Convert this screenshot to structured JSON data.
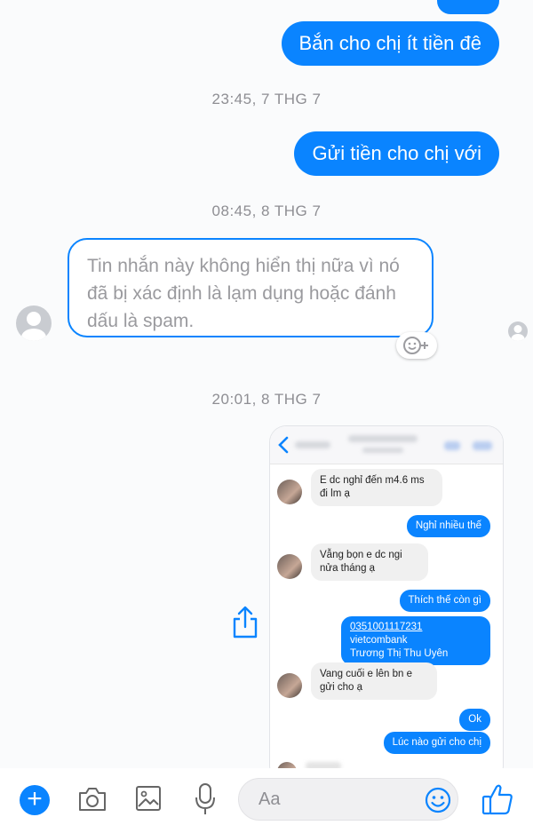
{
  "messages": {
    "out_1": "Bắn cho chị ít tiền đê",
    "ts_1": "23:45, 7 THG 7",
    "out_2": "Gửi tiền cho chị với",
    "ts_2": "08:45, 8 THG 7",
    "removed_notice": "Tin nhắn này không hiển thị nữa vì nó đã bị xác định là lạm dụng hoặc đánh dấu là spam.",
    "ts_3": "20:01, 8 THG 7"
  },
  "screenshot": {
    "msgs": [
      {
        "dir": "in",
        "text": "E dc nghỉ đến m4.6 ms đi lm ạ"
      },
      {
        "dir": "out",
        "text": "Nghỉ nhiều thế"
      },
      {
        "dir": "in",
        "text": "Vẫng bọn e dc ngi nửa tháng ạ"
      },
      {
        "dir": "out",
        "text": "Thích thế còn gì"
      },
      {
        "dir": "out_account",
        "account": "0351001117231",
        "bank": "vietcombank",
        "name": "Trương Thị Thu Uyên"
      },
      {
        "dir": "in",
        "text": "Vang cuối e lên bn e gửi cho ạ"
      },
      {
        "dir": "out",
        "text": "Ok"
      },
      {
        "dir": "out",
        "text": "Lúc nào gửi cho chị"
      }
    ]
  },
  "composer": {
    "placeholder": "Aa",
    "icons": [
      "plus-icon",
      "camera-icon",
      "image-icon",
      "microphone-icon",
      "emoji-icon",
      "like-icon"
    ]
  },
  "colors": {
    "accent": "#0a84ff",
    "timestamp": "#8e8e93"
  }
}
